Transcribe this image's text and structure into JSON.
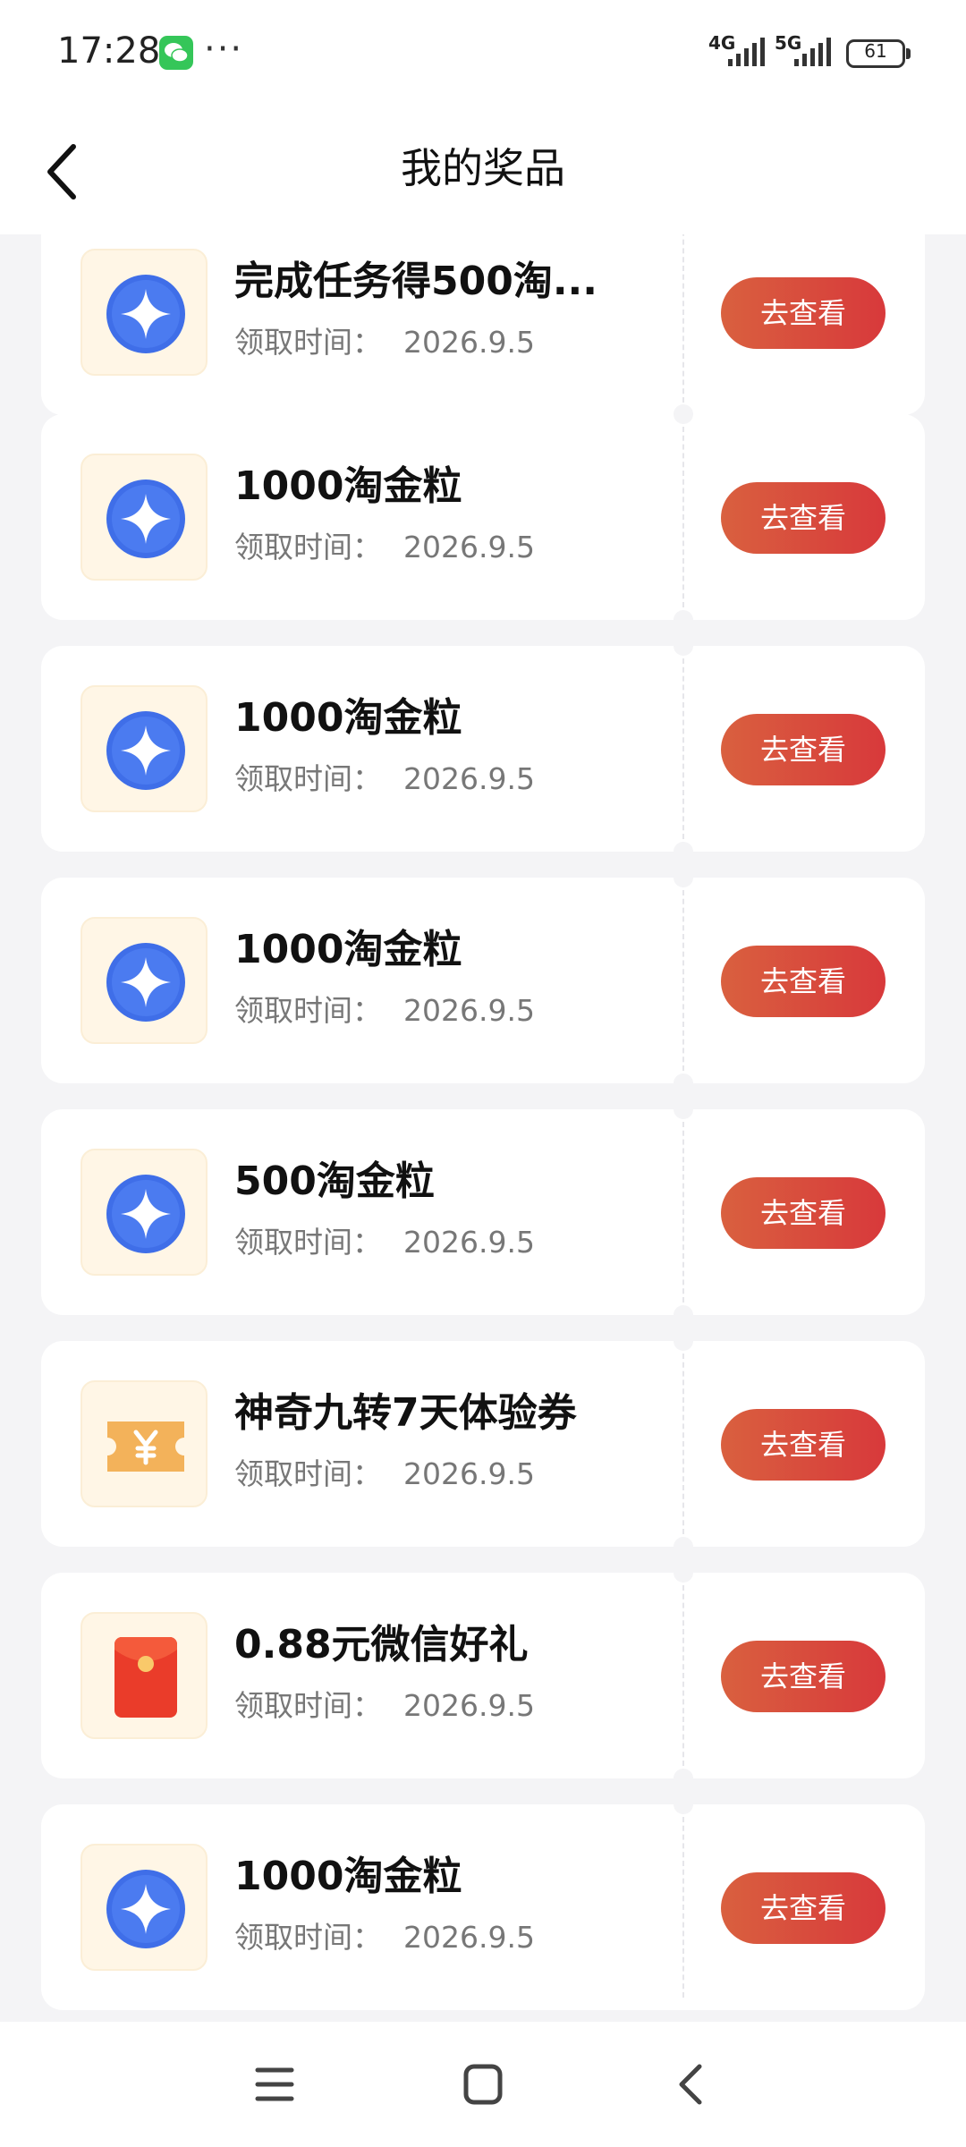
{
  "status_bar": {
    "time": "17:28",
    "net1": "4G",
    "net2": "5G",
    "battery": "61",
    "more": "···"
  },
  "header": {
    "title": "我的奖品",
    "back_icon": "chevron-left-icon"
  },
  "prizes": [
    {
      "name": "完成任务得500淘...",
      "time_label": "领取时间：",
      "date": "2026.9.5",
      "button": "去查看",
      "icon": "taojin-coin-icon"
    },
    {
      "name": "1000淘金粒",
      "time_label": "领取时间：",
      "date": "2026.9.5",
      "button": "去查看",
      "icon": "taojin-coin-icon"
    },
    {
      "name": "1000淘金粒",
      "time_label": "领取时间：",
      "date": "2026.9.5",
      "button": "去查看",
      "icon": "taojin-coin-icon"
    },
    {
      "name": "1000淘金粒",
      "time_label": "领取时间：",
      "date": "2026.9.5",
      "button": "去查看",
      "icon": "taojin-coin-icon"
    },
    {
      "name": "500淘金粒",
      "time_label": "领取时间：",
      "date": "2026.9.5",
      "button": "去查看",
      "icon": "taojin-coin-icon"
    },
    {
      "name": "神奇九转7天体验券",
      "time_label": "领取时间：",
      "date": "2026.9.5",
      "button": "去查看",
      "icon": "voucher-ticket-icon"
    },
    {
      "name": "0.88元微信好礼",
      "time_label": "领取时间：",
      "date": "2026.9.5",
      "button": "去查看",
      "icon": "red-envelope-icon"
    },
    {
      "name": "1000淘金粒",
      "time_label": "领取时间：",
      "date": "2026.9.5",
      "button": "去查看",
      "icon": "taojin-coin-icon"
    }
  ],
  "system_nav": {
    "menu_icon": "menu-icon",
    "home_icon": "home-square-icon",
    "back_icon": "back-chevron-icon"
  },
  "colors": {
    "button_start": "#d9603f",
    "button_end": "#d8393b",
    "coin_blue": "#3f6ee8",
    "thumb_bg": "#fff6e6"
  }
}
